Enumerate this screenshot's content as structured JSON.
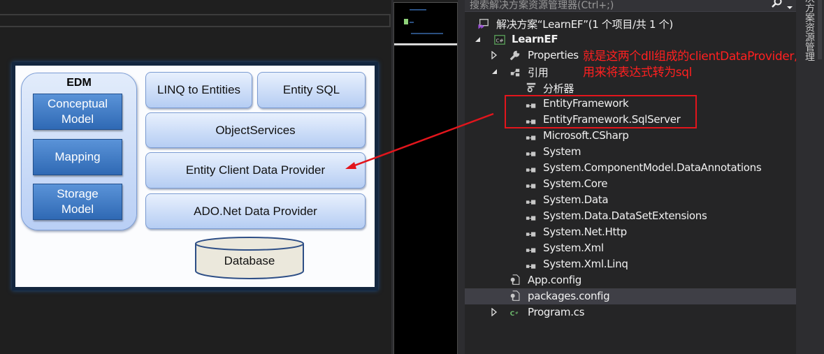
{
  "diagram": {
    "edm_title": "EDM",
    "edm_items": [
      "Conceptual\nModel",
      "Mapping",
      "Storage\nModel"
    ],
    "layers": {
      "linq": "LINQ to Entities",
      "entity_sql": "Entity SQL",
      "object_services": "ObjectServices",
      "entity_client": "Entity Client Data Provider",
      "ado_net": "ADO.Net Data Provider"
    },
    "database": "Database"
  },
  "explorer": {
    "search_placeholder": "搜索解决方案资源管理器(Ctrl+;)",
    "solution": "解决方案“LearnEF”(1 个项目/共 1 个)",
    "project": "LearnEF",
    "properties": "Properties",
    "references": "引用",
    "analyzers": "分析器",
    "reference_items": [
      "EntityFramework",
      "EntityFramework.SqlServer",
      "Microsoft.CSharp",
      "System",
      "System.ComponentModel.DataAnnotations",
      "System.Core",
      "System.Data",
      "System.Data.DataSetExtensions",
      "System.Net.Http",
      "System.Xml",
      "System.Xml.Linq"
    ],
    "files": [
      "App.config",
      "packages.config",
      "Program.cs"
    ],
    "selected_file": "packages.config"
  },
  "annotation": {
    "line1": "就是这两个dll组成的clientDataProvider,",
    "line2": "用来将表达式转为sql",
    "color": "#ff2020"
  },
  "side_tab": "解决方案资源管理器",
  "colors": {
    "explorer_bg": "#252526",
    "selected_row": "#3f3f46",
    "highlight_box": "#e2151c",
    "edm_item": "#3a76c4"
  }
}
